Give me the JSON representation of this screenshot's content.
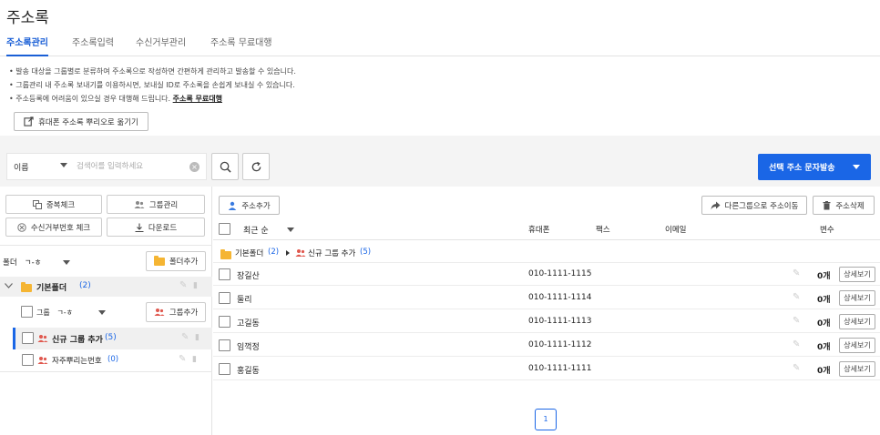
{
  "page_title": "주소록",
  "tabs": [
    {
      "label": "주소록관리",
      "active": true
    },
    {
      "label": "주소록입력",
      "active": false
    },
    {
      "label": "수신거부관리",
      "active": false
    },
    {
      "label": "주소록 무료대행",
      "active": false
    }
  ],
  "notes": [
    "발송 대상을 그룹별로 분류하여 주소록으로 작성하면 간편하게 관리하고 발송할 수 있습니다.",
    "그룹관리 내 주소록 보내기를 이용하시면, 보내실 ID로 주소록을 손쉽게 보내실 수 있습니다.",
    "주소등록에 어려움이 있으실 경우 대행해 드립니다."
  ],
  "note_link": "주소록 무료대행",
  "import_button": "휴대폰 주소록 뿌리오로 옮기기",
  "search": {
    "field_select": "이름",
    "placeholder": "검색어를 입력하세요"
  },
  "send_button": "선택 주소 문자발송",
  "left_buttons": {
    "dup_check": "중복체크",
    "group_manage": "그룹관리",
    "reject_check": "수신거부번호 체크",
    "download": "다운로드"
  },
  "folder_sort": {
    "label": "폴더",
    "value": "ㄱ-ㅎ"
  },
  "add_folder": "폴더추가",
  "folder": {
    "name": "기본폴더",
    "count": "(2)"
  },
  "group_sort": {
    "label": "그룹",
    "value": "ㄱ-ㅎ"
  },
  "add_group": "그룹추가",
  "groups": [
    {
      "name": "신규 그룹 추가",
      "count": "(5)",
      "selected": true
    },
    {
      "name": "자주뿌리는번호",
      "count": "(0)",
      "selected": false
    }
  ],
  "toolbar": {
    "add_address": "주소추가",
    "move": "다른그룹으로 주소이동",
    "delete": "주소삭제"
  },
  "table_header": {
    "sort": "최근 순",
    "phone": "휴대폰",
    "fax": "팩스",
    "email": "이메일",
    "vars": "변수"
  },
  "breadcrumb": {
    "folder": "기본폴더",
    "folder_count": "(2)",
    "group": "신규 그룹 추가",
    "group_count": "(5)"
  },
  "rows": [
    {
      "name": "장길산",
      "phone": "010-1111-1115",
      "count": "0개",
      "detail": "상세보기"
    },
    {
      "name": "둘리",
      "phone": "010-1111-1114",
      "count": "0개",
      "detail": "상세보기"
    },
    {
      "name": "고길동",
      "phone": "010-1111-1113",
      "count": "0개",
      "detail": "상세보기"
    },
    {
      "name": "임꺽정",
      "phone": "010-1111-1112",
      "count": "0개",
      "detail": "상세보기"
    },
    {
      "name": "홍길동",
      "phone": "010-1111-1111",
      "count": "0개",
      "detail": "상세보기"
    }
  ],
  "pagination": {
    "current": "1"
  },
  "colors": {
    "accent": "#1a66e6",
    "folder": "#f5b533",
    "group": "#e0584e"
  }
}
